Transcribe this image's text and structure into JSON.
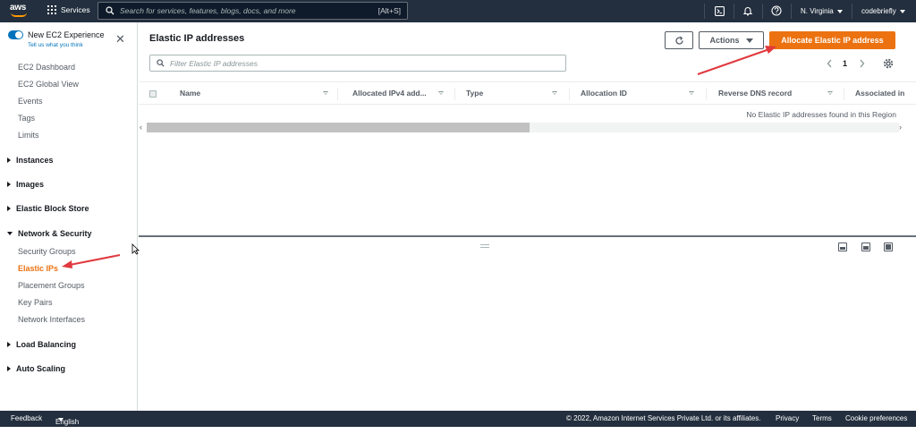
{
  "topnav": {
    "logo_text": "aws",
    "services_label": "Services",
    "search_placeholder": "Search for services, features, blogs, docs, and more",
    "search_shortcut": "[Alt+S]",
    "region": "N. Virginia",
    "account": "codebriefly"
  },
  "sidebar": {
    "toggle_label": "New EC2 Experience",
    "tell_us": "Tell us what you think",
    "top_items": [
      "EC2 Dashboard",
      "EC2 Global View",
      "Events",
      "Tags",
      "Limits"
    ],
    "groups": {
      "instances": "Instances",
      "images": "Images",
      "ebs": "Elastic Block Store",
      "network_security": "Network & Security",
      "load_balancing": "Load Balancing",
      "auto_scaling": "Auto Scaling"
    },
    "network_items": [
      "Security Groups",
      "Elastic IPs",
      "Placement Groups",
      "Key Pairs",
      "Network Interfaces"
    ],
    "active_item": "Elastic IPs"
  },
  "main": {
    "title": "Elastic IP addresses",
    "actions_label": "Actions",
    "allocate_label": "Allocate Elastic IP address",
    "filter_placeholder": "Filter Elastic IP addresses",
    "page_number": "1",
    "columns": [
      "Name",
      "Allocated IPv4 add...",
      "Type",
      "Allocation ID",
      "Reverse DNS record",
      "Associated in"
    ],
    "empty_message": "No Elastic IP addresses found in this Region"
  },
  "footer": {
    "feedback": "Feedback",
    "language": "English (US)",
    "copyright": "© 2022, Amazon Internet Services Private Ltd. or its affiliates.",
    "privacy": "Privacy",
    "terms": "Terms",
    "cookies": "Cookie preferences"
  },
  "colors": {
    "nav_bg": "#232f3e",
    "accent_orange": "#ec7211",
    "toggle_blue": "#0073bb",
    "annotation_red": "#e0393e"
  },
  "icons": [
    "grid-icon",
    "search-icon",
    "cloudshell-icon",
    "bell-icon",
    "help-icon",
    "close-icon",
    "refresh-icon",
    "settings-icon",
    "chevron-left-icon",
    "chevron-right-icon"
  ]
}
